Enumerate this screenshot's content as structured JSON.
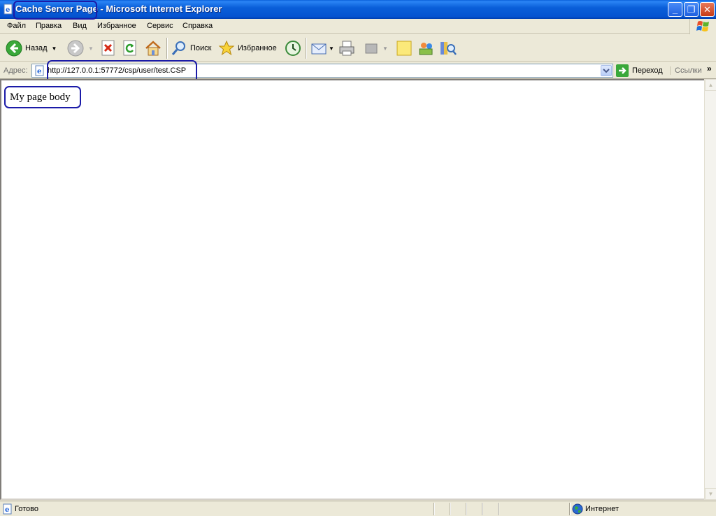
{
  "window": {
    "title_page": "Cache Server Page",
    "title_rest": " - Microsoft Internet Explorer",
    "minimize_glyph": "_",
    "maximize_glyph": "❐",
    "close_glyph": "✕"
  },
  "menu": {
    "items": [
      "Файл",
      "Правка",
      "Вид",
      "Избранное",
      "Сервис",
      "Справка"
    ]
  },
  "toolbar": {
    "back_label": "Назад",
    "search_label": "Поиск",
    "favorites_label": "Избранное"
  },
  "address": {
    "label": "Адрес:",
    "url": "http://127.0.0.1:57772/csp/user/test.CSP",
    "go_label": "Переход",
    "links_label": "Ссылки",
    "links_chevron": "»"
  },
  "page": {
    "body_text": "My page body"
  },
  "status": {
    "text": "Готово",
    "zone": "Интернет"
  },
  "colors": {
    "title_bar": "#0a5fd9",
    "chrome": "#ece9d8",
    "annotation": "#1b1ba8"
  }
}
